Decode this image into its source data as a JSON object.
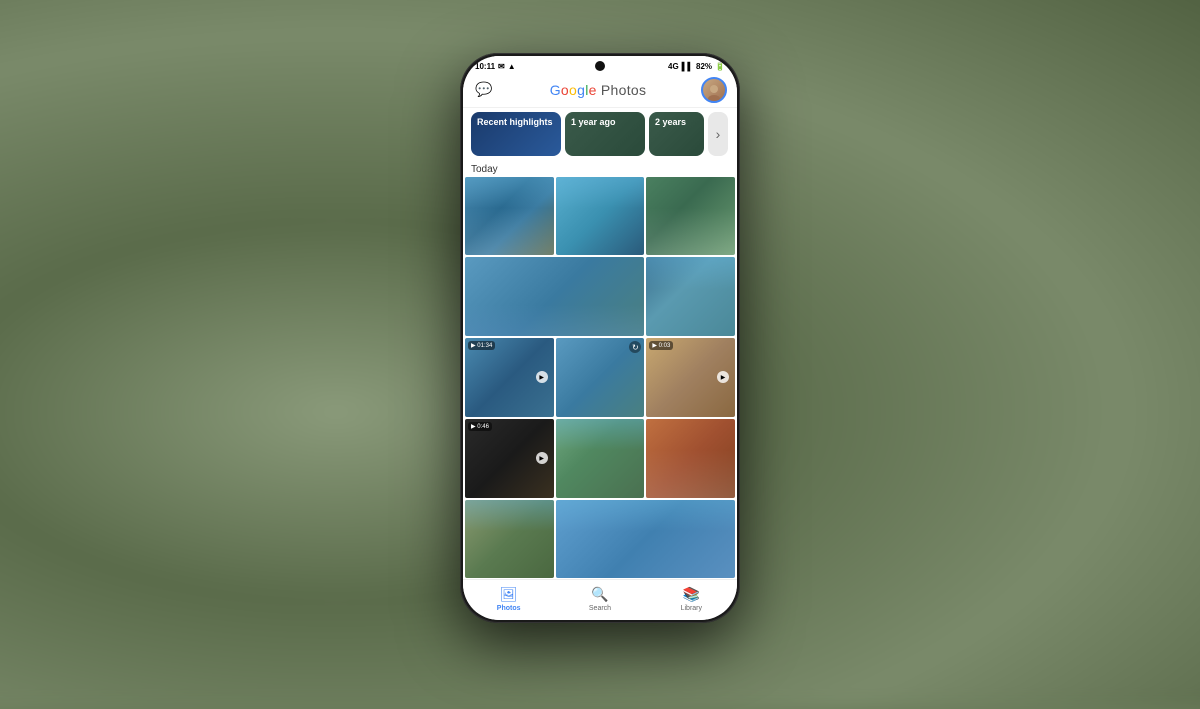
{
  "background": {
    "color": "#6b7c5a"
  },
  "phone": {
    "status_bar": {
      "time": "10:11",
      "network": "4G",
      "battery": "82%",
      "signal_icon": "signal",
      "wifi_icon": "wifi",
      "battery_icon": "battery"
    },
    "header": {
      "title": "Google Photos",
      "title_parts": {
        "G": "G",
        "o1": "o",
        "o2": "o",
        "g": "g",
        "l": "l",
        "e": "e",
        "space": " ",
        "P": "Photos"
      },
      "message_icon": "💬",
      "avatar_icon": "👤"
    },
    "memories": {
      "cards": [
        {
          "label": "Recent highlights",
          "type": "active"
        },
        {
          "label": "1 year ago",
          "type": "normal"
        },
        {
          "label": "2 years",
          "type": "normal"
        }
      ],
      "more_label": "›"
    },
    "section": {
      "label": "Today"
    },
    "photo_grid": {
      "rows": [
        {
          "cells": [
            {
              "id": "p1",
              "color_class": "photo-c1",
              "type": "photo",
              "wide": false
            },
            {
              "id": "p2",
              "color_class": "photo-c2",
              "type": "photo",
              "wide": false
            },
            {
              "id": "p3",
              "color_class": "photo-c3",
              "type": "photo",
              "wide": false
            }
          ]
        },
        {
          "cells": [
            {
              "id": "p4",
              "color_class": "photo-c4",
              "type": "photo",
              "wide": true
            },
            {
              "id": "p5",
              "color_class": "photo-c6",
              "type": "photo",
              "wide": false
            }
          ]
        },
        {
          "cells": [
            {
              "id": "p6",
              "color_class": "photo-c5",
              "type": "video",
              "duration": "01:34",
              "wide": false
            },
            {
              "id": "p7",
              "color_class": "photo-c4",
              "type": "motion",
              "wide": false
            },
            {
              "id": "p8",
              "color_class": "photo-c7",
              "type": "video",
              "duration": "0:03",
              "wide": false
            }
          ]
        },
        {
          "cells": [
            {
              "id": "p9",
              "color_class": "photo-c8",
              "type": "video",
              "duration": "0:46",
              "wide": false
            },
            {
              "id": "p10",
              "color_class": "photo-c9",
              "type": "photo",
              "wide": false
            },
            {
              "id": "p11",
              "color_class": "photo-c11",
              "type": "photo",
              "wide": false
            }
          ]
        },
        {
          "cells": [
            {
              "id": "p12",
              "color_class": "photo-c10",
              "type": "photo",
              "wide": false
            },
            {
              "id": "p13",
              "color_class": "photo-c12",
              "type": "photo",
              "wide": true
            }
          ]
        }
      ]
    },
    "bottom_nav": {
      "items": [
        {
          "label": "Photos",
          "icon": "🖼",
          "active": true
        },
        {
          "label": "Search",
          "icon": "🔍",
          "active": false
        },
        {
          "label": "Library",
          "icon": "📚",
          "active": false
        }
      ]
    }
  }
}
